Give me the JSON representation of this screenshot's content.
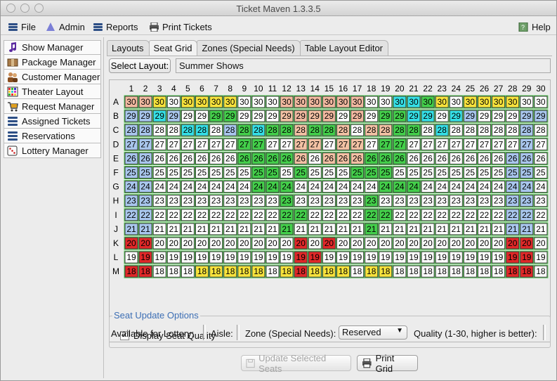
{
  "window": {
    "title": "Ticket Maven 1.3.3.5"
  },
  "menubar": {
    "items": [
      {
        "label": "File",
        "icon": "list-icon"
      },
      {
        "label": "Admin",
        "icon": "wizard-hat-icon"
      },
      {
        "label": "Reports",
        "icon": "list-icon"
      },
      {
        "label": "Print Tickets",
        "icon": "printer-icon"
      }
    ],
    "help": {
      "label": "Help",
      "icon": "help-book-icon"
    }
  },
  "sidebar": {
    "items": [
      {
        "label": "Show Manager",
        "icon": "music-note-icon"
      },
      {
        "label": "Package Manager",
        "icon": "package-icon"
      },
      {
        "label": "Customer Manager",
        "icon": "people-icon"
      },
      {
        "label": "Theater Layout",
        "icon": "grid-icon"
      },
      {
        "label": "Request Manager",
        "icon": "cart-icon"
      },
      {
        "label": "Assigned Tickets",
        "icon": "list-icon"
      },
      {
        "label": "Reservations",
        "icon": "list-icon"
      },
      {
        "label": "Lottery Manager",
        "icon": "dice-icon"
      }
    ]
  },
  "tabs": [
    {
      "label": "Layouts",
      "active": false
    },
    {
      "label": "Seat Grid",
      "active": true
    },
    {
      "label": "Zones (Special Needs)",
      "active": false
    },
    {
      "label": "Table Layout Editor",
      "active": false
    }
  ],
  "layout_select": {
    "button_label": "Select Layout:",
    "value": "Summer Shows"
  },
  "seat_grid": {
    "columns": [
      "1",
      "2",
      "3",
      "4",
      "5",
      "6",
      "7",
      "8",
      "9",
      "10",
      "11",
      "12",
      "13",
      "14",
      "15",
      "16",
      "17",
      "18",
      "19",
      "20",
      "21",
      "22",
      "23",
      "24",
      "25",
      "26",
      "27",
      "28",
      "29",
      "30"
    ],
    "rows": [
      {
        "label": "A",
        "quality": 30,
        "pattern": "ppywyyyywwwppppppwwccgywyyyywwp"
      },
      {
        "label": "B",
        "quality": 29,
        "pattern": "bbcbwwggwwwspspwpwggccwcbwwwbb"
      },
      {
        "label": "C",
        "quality": 28,
        "pattern": "bbwwccwbgcggsggswssggwcwwwwwb"
      },
      {
        "label": "D",
        "quality": 27,
        "pattern": "bbwwwwwwggwwsswsswggwwwwwwwwb"
      },
      {
        "label": "E",
        "quality": 26,
        "pattern": "bbwwwwwwggggswsssgggwwwwwwwbb"
      },
      {
        "label": "F",
        "quality": 25,
        "pattern": "bbwwwwwwwggwgwwwgggwwwwwwwwbb"
      },
      {
        "label": "G",
        "quality": 24,
        "pattern": "bbwwwwwwwgggwwwwwwgggwwwwwwbb"
      },
      {
        "label": "H",
        "quality": 23,
        "pattern": "bbwwwwwwwwwgwwwwwgwwwwwwwwwbb"
      },
      {
        "label": "I",
        "quality": 22,
        "pattern": "bbwwwwwwwwwggwwwwggwwwwwwwwbb"
      },
      {
        "label": "J",
        "quality": 21,
        "pattern": "bbwwwwwwwwwgwwwwwgwwwwwwwwwbb"
      },
      {
        "label": "K",
        "quality": 20,
        "pattern": "rrwwwwwwwwwwrwrwwwwwwwwwwwwrr"
      },
      {
        "label": "L",
        "quality": 19,
        "pattern": "wrwwwwwwwwwwrrwwwwwwwwwwwwwrr"
      },
      {
        "label": "M",
        "quality": 18,
        "pattern": "rrwwwyyyyywyryyywyywwwwwwwwrr"
      }
    ]
  },
  "seat_colors": {
    "w": "#ffffff",
    "y": "#f7e33b",
    "p": "#f2b9a0",
    "c": "#34e0e6",
    "g": "#43cf4a",
    "b": "#a9c7ee",
    "s": "#f3c2a4",
    "r": "#e02828"
  },
  "display_seat_quality": {
    "label": "Display Seat Quality",
    "checked": true
  },
  "seat_update_options": {
    "title": "Seat Update Options",
    "available_for_lottery": "Available for Lottery:",
    "aisle": "Aisle:",
    "zone_label": "Zone (Special Needs):",
    "zone_value": "Reserved",
    "quality_label": "Quality (1-30, higher is better):"
  },
  "buttons": {
    "update_selected_seats": {
      "label": "Update Selected Seats",
      "disabled": true
    },
    "print_grid": {
      "label": "Print Grid"
    }
  }
}
